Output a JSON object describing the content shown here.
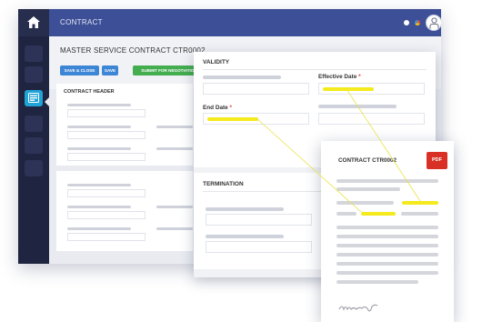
{
  "app": {
    "title": "CONTRACT",
    "page_title": "MASTER SERVICE CONTRACT CTR0002",
    "actions": {
      "save_close": "SAVE & CLOSE",
      "save": "SAVE",
      "submit": "SUBMIT FOR NEGOTIATION"
    },
    "contract_header_label": "CONTRACT HEADER",
    "rail_icons": [
      "home-icon",
      "form-icon"
    ],
    "colors": {
      "rail": "#1f2540",
      "topbar": "#3d4f96",
      "active": "#20a3d6",
      "save": "#3d86d6",
      "submit": "#43ad4f"
    }
  },
  "panel": {
    "validity": {
      "title": "VALIDITY",
      "effective_date_label": "Effective Date",
      "end_date_label": "End Date",
      "required_marker": "*"
    },
    "termination": {
      "title": "TERMINATION"
    }
  },
  "document": {
    "title": "CONTRACT CTR0002",
    "badge": "PDF",
    "highlight_color": "#f4ea1d"
  }
}
